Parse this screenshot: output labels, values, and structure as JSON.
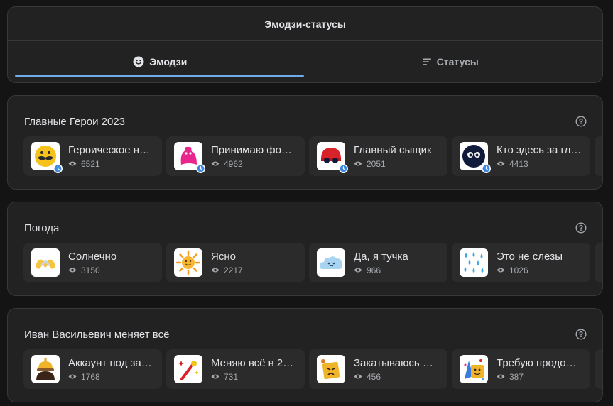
{
  "header": {
    "title": "Эмодзи-статусы",
    "tabs": [
      {
        "label": "Эмодзи",
        "icon": "smile-icon",
        "active": true
      },
      {
        "label": "Статусы",
        "icon": "lines-icon",
        "active": false
      }
    ]
  },
  "colors": {
    "accent": "#71aaeb",
    "panel": "#222222",
    "card": "#2b2b2b",
    "page": "#141414"
  },
  "sections": [
    {
      "title": "Главные Герои 2023",
      "items": [
        {
          "title": "Героическое н…",
          "views": "6521",
          "icon": "yellow-mustache-face-icon",
          "timed": true
        },
        {
          "title": "Принимаю фо…",
          "views": "4962",
          "icon": "pink-ghost-icon",
          "timed": true
        },
        {
          "title": "Главный сыщик",
          "views": "2051",
          "icon": "red-detective-icon",
          "timed": true
        },
        {
          "title": "Кто здесь за гл…",
          "views": "4413",
          "icon": "dark-ball-eyes-icon",
          "timed": true
        }
      ]
    },
    {
      "title": "Погода",
      "items": [
        {
          "title": "Солнечно",
          "views": "3150",
          "icon": "heart-hands-icon",
          "timed": false
        },
        {
          "title": "Ясно",
          "views": "2217",
          "icon": "sun-face-icon",
          "timed": false
        },
        {
          "title": "Да, я тучка",
          "views": "966",
          "icon": "cloud-face-icon",
          "timed": false
        },
        {
          "title": "Это не слёзы",
          "views": "1026",
          "icon": "rain-drops-icon",
          "timed": false
        }
      ]
    },
    {
      "title": "Иван Васильевич меняет всё",
      "items": [
        {
          "title": "Аккаунт под за…",
          "views": "1768",
          "icon": "tsar-crown-icon",
          "timed": false
        },
        {
          "title": "Меняю всё в 2…",
          "views": "731",
          "icon": "magic-wand-icon",
          "timed": false
        },
        {
          "title": "Закатываюсь о…",
          "views": "456",
          "icon": "angry-cube-icon",
          "timed": false
        },
        {
          "title": "Требую продо…",
          "views": "387",
          "icon": "party-face-icon",
          "timed": false
        }
      ]
    }
  ]
}
